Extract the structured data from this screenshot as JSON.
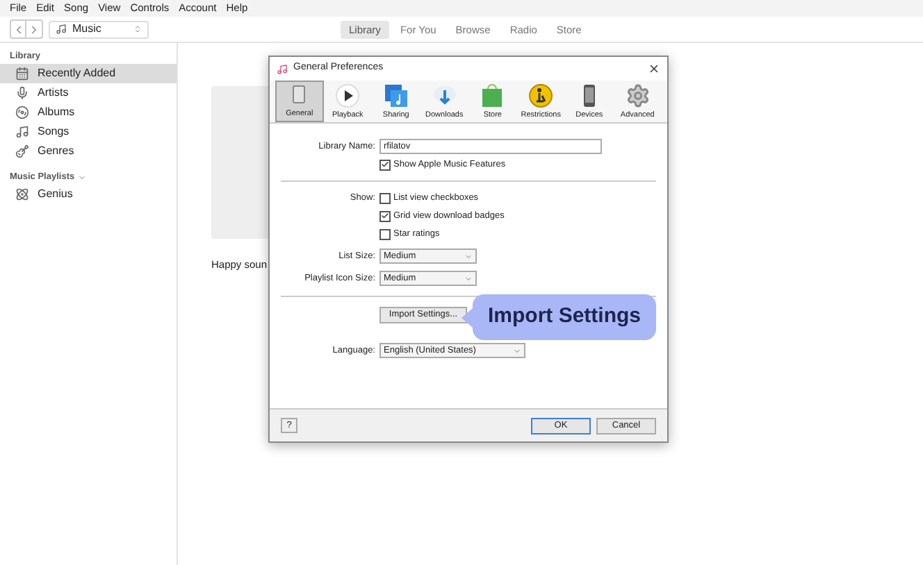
{
  "menu": [
    "File",
    "Edit",
    "Song",
    "View",
    "Controls",
    "Account",
    "Help"
  ],
  "toolbar": {
    "source": "Music",
    "tabs": [
      {
        "label": "Library",
        "selected": true
      },
      {
        "label": "For You",
        "selected": false
      },
      {
        "label": "Browse",
        "selected": false
      },
      {
        "label": "Radio",
        "selected": false
      },
      {
        "label": "Store",
        "selected": false
      }
    ]
  },
  "sidebar": {
    "sections": [
      {
        "title": "Library",
        "kind": "library",
        "items": [
          {
            "label": "Recently Added",
            "kind": "grid",
            "selected": true
          },
          {
            "label": "Artists",
            "kind": "mic",
            "selected": false
          },
          {
            "label": "Albums",
            "kind": "album",
            "selected": false
          },
          {
            "label": "Songs",
            "kind": "note",
            "selected": false
          },
          {
            "label": "Genres",
            "kind": "guitar",
            "selected": false
          }
        ]
      },
      {
        "title": "Music Playlists",
        "kind": "playlists",
        "items": [
          {
            "label": "Genius",
            "kind": "atom",
            "selected": false
          }
        ]
      }
    ]
  },
  "content": {
    "album_caption": "Happy soun"
  },
  "dialog": {
    "title": "General Preferences",
    "tabs": [
      {
        "label": "General",
        "kind": "general",
        "selected": true
      },
      {
        "label": "Playback",
        "kind": "playback",
        "selected": false
      },
      {
        "label": "Sharing",
        "kind": "sharing",
        "selected": false
      },
      {
        "label": "Downloads",
        "kind": "downloads",
        "selected": false
      },
      {
        "label": "Store",
        "kind": "store",
        "selected": false
      },
      {
        "label": "Restrictions",
        "kind": "restrictions",
        "selected": false
      },
      {
        "label": "Devices",
        "kind": "devices",
        "selected": false
      },
      {
        "label": "Advanced",
        "kind": "advanced",
        "selected": false
      }
    ],
    "library_name": {
      "label": "Library Name:",
      "value": "rfilatov"
    },
    "apple_music": {
      "label": "Show Apple Music Features",
      "checked": true
    },
    "show": {
      "label": "Show:",
      "options": [
        {
          "label": "List view checkboxes",
          "checked": false
        },
        {
          "label": "Grid view download badges",
          "checked": true
        },
        {
          "label": "Star ratings",
          "checked": false
        }
      ]
    },
    "list_size": {
      "label": "List Size:",
      "value": "Medium"
    },
    "playlist_icon_size": {
      "label": "Playlist Icon Size:",
      "value": "Medium"
    },
    "import_button": "Import Settings...",
    "language": {
      "label": "Language:",
      "value": "English (United States)"
    },
    "help_button": "?",
    "ok_button": "OK",
    "cancel_button": "Cancel"
  },
  "callout": "Import Settings"
}
